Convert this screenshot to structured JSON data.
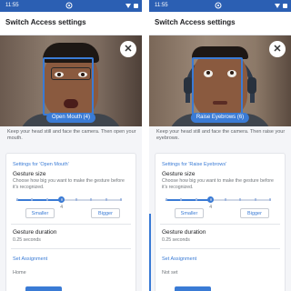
{
  "status_bar": {
    "time": "11:55"
  },
  "screens": [
    {
      "app_title": "Switch Access settings",
      "gesture_label": "Open Mouth (4)",
      "instructions": "Keep your head still and face the camera. Then open your mouth.",
      "settings_for": "Settings for 'Open Mouth'",
      "gesture_size_title": "Gesture size",
      "gesture_size_desc": "Choose how big you want to make the gesture before it's recognized.",
      "slider": {
        "value": 4,
        "value_label": "4",
        "ticks": 8
      },
      "smaller_label": "Smaller",
      "bigger_label": "Bigger",
      "duration_title": "Gesture duration",
      "duration_value": "0.25 seconds",
      "set_assignment": "Set Assignment",
      "assignment_value": "Home"
    },
    {
      "app_title": "Switch Access settings",
      "gesture_label": "Raise Eyebrows (6)",
      "instructions": "Keep your head still and face the camera. Then raise your eyebrows.",
      "settings_for": "Settings for 'Raise Eyebrows'",
      "gesture_size_title": "Gesture size",
      "gesture_size_desc": "Choose how big you want to make the gesture before it's recognized.",
      "slider": {
        "value": 4,
        "value_label": "4",
        "ticks": 8
      },
      "smaller_label": "Smaller",
      "bigger_label": "Bigger",
      "duration_title": "Gesture duration",
      "duration_value": "0.25 seconds",
      "set_assignment": "Set Assignment",
      "assignment_value": "Not set"
    }
  ],
  "icons": {
    "close": "close-icon",
    "status_app": "switch-access-icon",
    "wifi": "wifi-icon",
    "battery": "battery-icon"
  },
  "colors": {
    "accent": "#3a7bd5",
    "status_bar": "#2b5fb3"
  }
}
